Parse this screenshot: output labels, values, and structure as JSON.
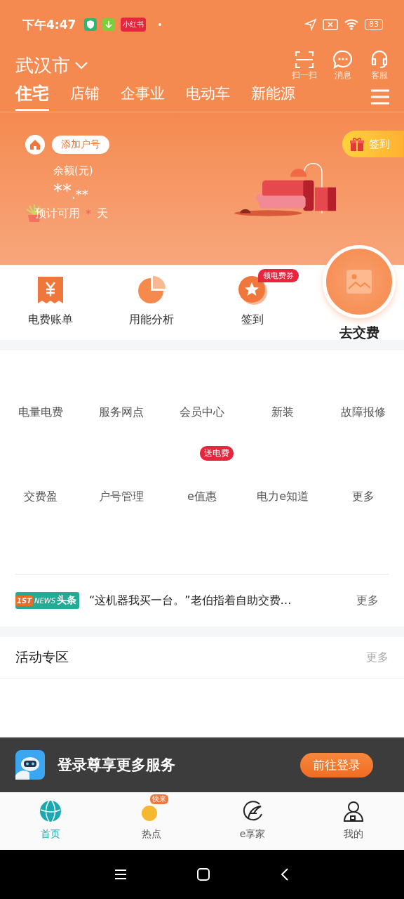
{
  "status_bar": {
    "time": "下午4:47",
    "app_badge": "小红书",
    "battery": "83"
  },
  "header": {
    "city": "武汉市",
    "actions": [
      {
        "label": "扫一扫",
        "kind": "scan"
      },
      {
        "label": "消息",
        "kind": "message"
      },
      {
        "label": "客服",
        "kind": "service"
      }
    ]
  },
  "tabs": [
    {
      "label": "住宅",
      "selected": true
    },
    {
      "label": "店铺",
      "selected": false
    },
    {
      "label": "企事业",
      "selected": false
    },
    {
      "label": "电动车",
      "selected": false
    },
    {
      "label": "新能源",
      "selected": false
    }
  ],
  "account": {
    "add_button": "添加户号",
    "balance_label": "余额(元)",
    "balance_int": "**",
    "balance_dec": ".**",
    "forecast_label": "预计可用",
    "forecast_value": "*",
    "forecast_unit": "天",
    "checkin_badge": "签到"
  },
  "quick_actions": [
    {
      "label": "电费账单",
      "kind": "bill"
    },
    {
      "label": "用能分析",
      "kind": "analysis"
    },
    {
      "label": "签到",
      "kind": "checkin",
      "badge": "领电费券"
    }
  ],
  "pay_button": "去交费",
  "services": [
    [
      {
        "label": "电量电费"
      },
      {
        "label": "服务网点"
      },
      {
        "label": "会员中心"
      },
      {
        "label": "新装"
      },
      {
        "label": "故障报修"
      }
    ],
    [
      {
        "label": "交费盈"
      },
      {
        "label": "户号管理"
      },
      {
        "label": "e值惠",
        "badge": "送电费"
      },
      {
        "label": "电力e知道"
      },
      {
        "label": "更多"
      }
    ]
  ],
  "news": {
    "logo_top": "1ST",
    "logo_news": "NEWS",
    "logo_text": "头条",
    "headline": "“这机器我买一台。”老伯指着自助交费…",
    "more": "更多"
  },
  "activity": {
    "title": "活动专区",
    "more": "更多"
  },
  "login_banner": {
    "text": "登录尊享更多服务",
    "button": "前往登录"
  },
  "bottom_nav": [
    {
      "label": "首页",
      "kind": "home",
      "selected": true
    },
    {
      "label": "热点",
      "kind": "hot",
      "selected": false,
      "badge": "快来"
    },
    {
      "label": "e享家",
      "kind": "ehome",
      "selected": false
    },
    {
      "label": "我的",
      "kind": "me",
      "selected": false
    }
  ]
}
